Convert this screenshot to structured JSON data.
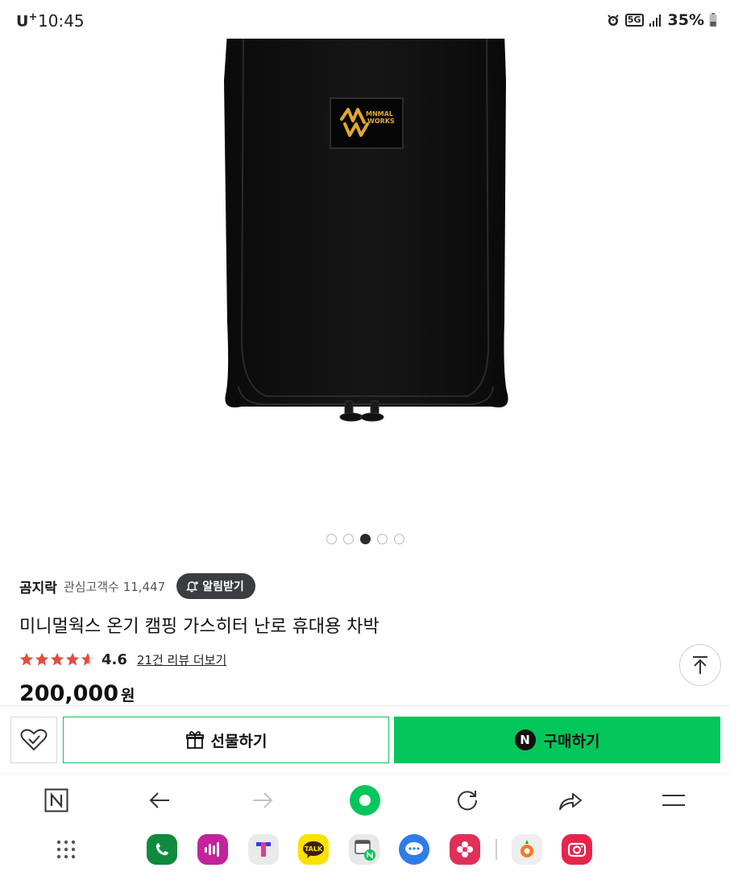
{
  "status_bar": {
    "carrier": "U",
    "carrier_sup": "+",
    "time": "10:45",
    "network": "5G",
    "battery": "35%"
  },
  "product_image": {
    "brand_label_line1": "MNMAL",
    "brand_label_line2": "WORKS",
    "logo_letters": "MW"
  },
  "carousel": {
    "count": 5,
    "active_index": 2
  },
  "store": {
    "name": "곰지락",
    "interest_label": "관심고객수 11,447",
    "alert_button": "알림받기"
  },
  "product": {
    "title": "미니멀웍스 온기 캠핑 가스히터 난로 휴대용 차박",
    "rating": "4.6",
    "rating_stars": 4.6,
    "review_link": "21건 리뷰 더보기",
    "price": "200,000",
    "currency": "원"
  },
  "purchase_bar": {
    "gift_label": "선물하기",
    "buy_label": "구매하기",
    "npay_letter": "N"
  },
  "browser_toolbar": {
    "items": [
      "naver-home",
      "back",
      "forward",
      "home-green",
      "refresh",
      "share",
      "menu"
    ]
  },
  "dock": {
    "apps": [
      "phone",
      "podcast",
      "t-app",
      "kakaotalk",
      "naver-browser",
      "messages",
      "flower",
      "carrot",
      "camera"
    ]
  },
  "colors": {
    "accent_green": "#03c75a",
    "star_red": "#e84b3c",
    "dark_button": "#3b3d40"
  }
}
